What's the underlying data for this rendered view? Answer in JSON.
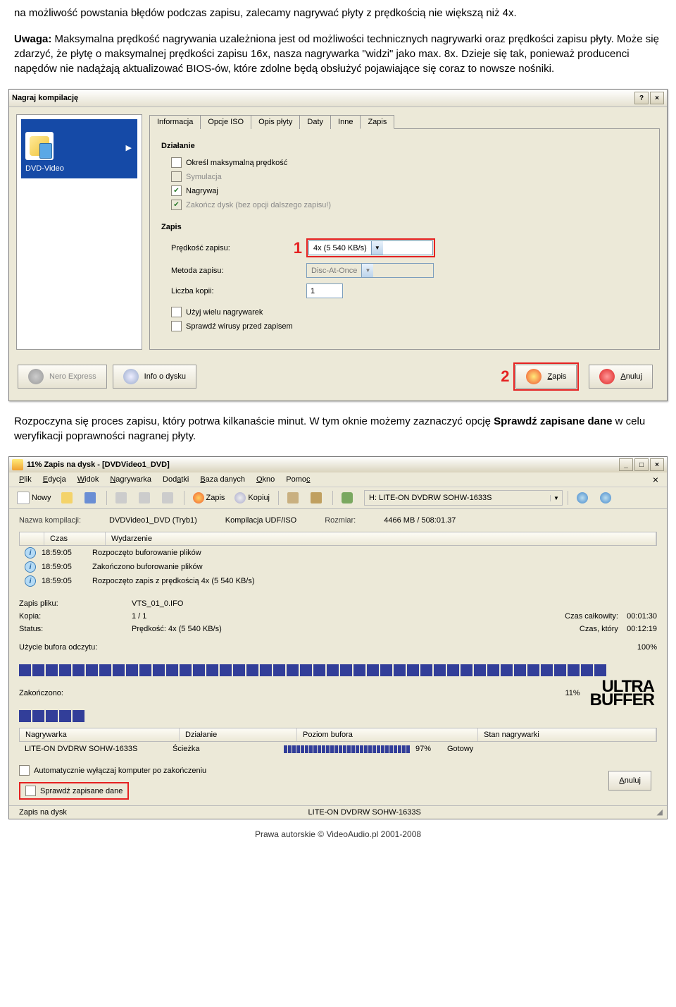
{
  "article": {
    "p1": "na możliwość powstania błędów podczas zapisu, zalecamy nagrywać płyty z prędkością nie większą niż 4x.",
    "p2_bold": "Uwaga:",
    "p2": " Maksymalna prędkość nagrywania uzależniona jest od możliwości technicznych nagrywarki oraz prędkości zapisu płyty. Może się zdarzyć, że płytę o maksymalnej prędkości zapisu 16x, nasza nagrywarka \"widzi\" jako max. 8x. Dzieje się tak, ponieważ producenci napędów nie nadążają aktualizować BIOS-ów, które zdolne będą obsłużyć pojawiające się coraz to nowsze nośniki.",
    "p3a": "Rozpoczyna się proces zapisu, który potrwa kilkanaście minut. W tym oknie możemy zaznaczyć opcję ",
    "p3b": "Sprawdź zapisane dane",
    "p3c": " w celu weryfikacji poprawności nagranej płyty."
  },
  "dlg1": {
    "title": "Nagraj kompilację",
    "mode": "DVD-Video",
    "tabs": [
      "Informacja",
      "Opcje ISO",
      "Opis płyty",
      "Daty",
      "Inne",
      "Zapis"
    ],
    "group1": "Działanie",
    "chk_max": "Określ maksymalną prędkość",
    "chk_sim": "Symulacja",
    "chk_write": "Nagrywaj",
    "chk_finalize": "Zakończ dysk (bez opcji dalszego zapisu!)",
    "group2": "Zapis",
    "lbl_speed": "Prędkość zapisu:",
    "val_speed": "4x (5 540 KB/s)",
    "lbl_method": "Metoda zapisu:",
    "val_method": "Disc-At-Once",
    "lbl_copies": "Liczba kopii:",
    "val_copies": "1",
    "chk_multi": "Użyj wielu nagrywarek",
    "chk_virus": "Sprawdź wirusy przed zapisem",
    "btn_nero": "Nero Express",
    "btn_info": "Info o dysku",
    "btn_burn": "Zapis",
    "btn_cancel": "Anuluj",
    "marker1": "1",
    "marker2": "2"
  },
  "dlg2": {
    "title": "11% Zapis na dysk - [DVDVideo1_DVD]",
    "menu": [
      "Plik",
      "Edycja",
      "Widok",
      "Nagrywarka",
      "Dodatki",
      "Baza danych",
      "Okno",
      "Pomoc"
    ],
    "tb_nowy": "Nowy",
    "tb_zapis": "Zapis",
    "tb_kopiuj": "Kopiuj",
    "drive": "H: LITE-ON DVDRW SOHW-1633S",
    "info": {
      "k1": "Nazwa kompilacji:",
      "v1": "DVDVideo1_DVD (Tryb1)",
      "k2": "Kompilacja UDF/ISO",
      "k3": "Rozmiar:",
      "v3": "4466 MB   /   508:01.37"
    },
    "ev_head": [
      "Czas",
      "Wydarzenie"
    ],
    "events": [
      {
        "t": "18:59:05",
        "d": "Rozpoczęto buforowanie plików"
      },
      {
        "t": "18:59:05",
        "d": "Zakończono buforowanie plików"
      },
      {
        "t": "18:59:05",
        "d": "Rozpoczęto zapis z prędkością 4x (5 540 KB/s)"
      }
    ],
    "status": {
      "k1": "Zapis pliku:",
      "v1": "VTS_01_0.IFO",
      "k2": "Kopia:",
      "v2": "1 / 1",
      "r2k": "Czas całkowity:",
      "r2v": "00:01:30",
      "k3": "Status:",
      "v3": "Prędkość: 4x (5 540 KB/s)",
      "r3k": "Czas, który",
      "r3v": "00:12:19",
      "k4": "Użycie bufora odczytu:",
      "r4": "100%",
      "k5": "Zakończono:",
      "r5": "11%"
    },
    "writer_head": [
      "Nagrywarka",
      "Działanie",
      "Poziom bufora",
      "Stan nagrywarki"
    ],
    "writer_row": {
      "n": "LITE-ON DVDRW SOHW-1633S",
      "a": "Ścieżka",
      "p": "97%",
      "s": "Gotowy"
    },
    "chk_shutdown": "Automatycznie wyłączaj komputer po zakończeniu",
    "chk_verify": "Sprawdź zapisane dane",
    "btn_cancel": "Anuluj",
    "status_left": "Zapis na dysk",
    "status_right": "LITE-ON DVDRW SOHW-1633S",
    "logo1": "ULTRA",
    "logo2": "BUFFER"
  },
  "copyright": "Prawa autorskie © VideoAudio.pl 2001-2008"
}
